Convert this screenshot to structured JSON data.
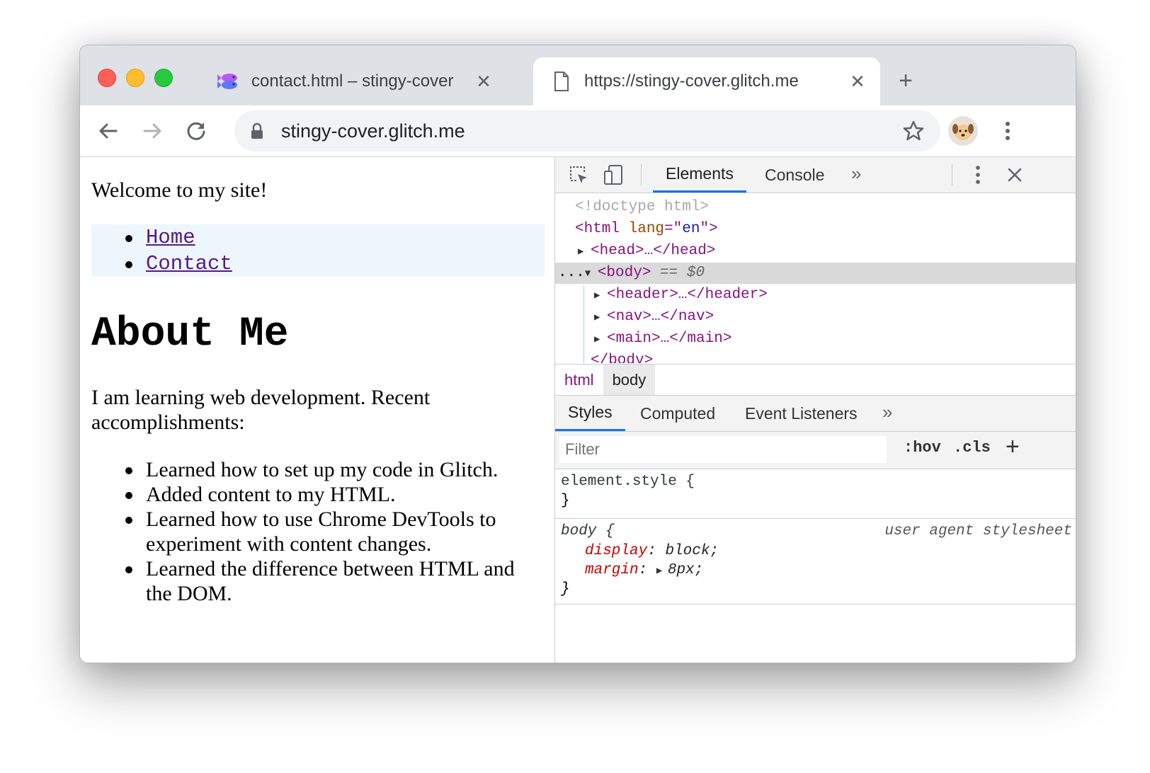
{
  "browser": {
    "tabs": [
      {
        "title": "contact.html – stingy-cover",
        "icon": "glitch-fish-icon",
        "active": false
      },
      {
        "title": "https://stingy-cover.glitch.me",
        "icon": "document-icon",
        "active": true
      }
    ],
    "address": "stingy-cover.glitch.me"
  },
  "page": {
    "welcome": "Welcome to my site!",
    "nav": [
      "Home",
      "Contact"
    ],
    "heading": "About Me",
    "intro": "I am learning web development. Recent accomplishments:",
    "accomplishments": [
      "Learned how to set up my code in Glitch.",
      "Added content to my HTML.",
      "Learned how to use Chrome DevTools to experiment with content changes.",
      "Learned the difference between HTML and the DOM."
    ]
  },
  "devtools": {
    "tabs": [
      "Elements",
      "Console"
    ],
    "active_tab": "Elements",
    "dom": {
      "doctype": "<!doctype html>",
      "html_open": "<html",
      "lang_attr": "lang",
      "lang_eq": "=\"",
      "lang_val": "en",
      "lang_close": "\">",
      "head": "<head>",
      "head_rest": "…</head>",
      "dots": "...",
      "body": "<body>",
      "body_eq": "== $0",
      "header": "<header>",
      "header_rest": "…</header>",
      "nav": "<nav>",
      "nav_rest": "…</nav>",
      "main": "<main>",
      "main_rest": "…</main>",
      "body_close": "</body>"
    },
    "breadcrumbs": [
      "html",
      "body"
    ],
    "style_tabs": [
      "Styles",
      "Computed",
      "Event Listeners"
    ],
    "filter_placeholder": "Filter",
    "hov": ":hov",
    "cls": ".cls",
    "rules": {
      "element_selector": "element.style {",
      "close_brace": "}",
      "body_selector": "body {",
      "ua_label": "user agent stylesheet",
      "display_prop": "display",
      "display_val": "block;",
      "margin_prop": "margin",
      "margin_val": "8px;"
    }
  }
}
